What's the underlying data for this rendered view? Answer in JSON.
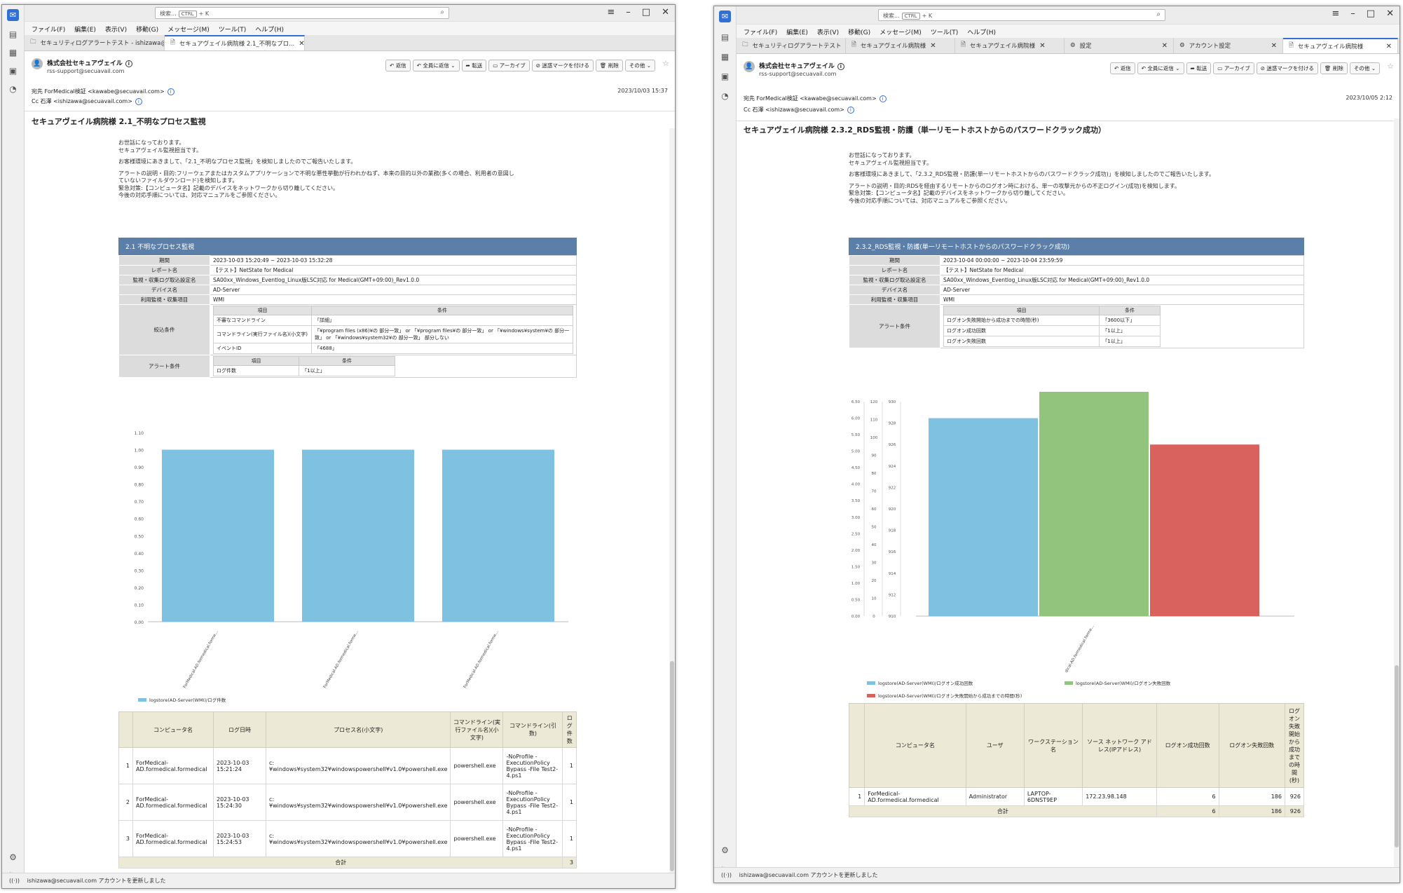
{
  "app": {
    "search_placeholder": "検索...",
    "search_key": "CTRL",
    "search_key2": "K",
    "menu": [
      "ファイル(F)",
      "編集(E)",
      "表示(V)",
      "移動(G)",
      "メッセージ(M)",
      "ツール(T)",
      "ヘルプ(H)"
    ],
    "status_text": "ishizawa@secuavail.com アカウントを更新しました",
    "sender_name": "株式会社セキュアヴェイル",
    "sender_email": "rss-support@secuavail.com",
    "actions": [
      "返信",
      "全員に返信",
      "転送",
      "アーカイブ",
      "迷惑マークを付ける",
      "削除",
      "その他"
    ]
  },
  "window1": {
    "tabs": [
      {
        "label": "セキュリティログアラートテスト - ishizawa@...",
        "active": false
      },
      {
        "label": "セキュアヴェイル病院様 2.1_不明なプロ...",
        "active": true
      }
    ],
    "to": "宛先 ForMedical検証 <kawabe@secuavail.com>",
    "cc": "Cc 石澤 <ishizawa@secuavail.com>",
    "date": "2023/10/03 15:37",
    "subject": "セキュアヴェイル病院様 2.1_不明なプロセス監視",
    "body": [
      "お世話になっております。",
      "セキュアヴェイル監視担当です。",
      "",
      "お客様環境にあきまして、「2.1_不明なプロセス監視」を検知しましたのでご報告いたします。",
      "",
      "アラートの説明・目的:フリーウェアまたはカスタムアプリケーションで不明な悪性挙動が行われかねず、本来の目的以外の業務(多くの場合、利用者の意図し",
      "ていないファイルダウンロード)を検知します。",
      "緊急対策:【コンピュータ名】記載のデバイスをネットワークから切り離してください。",
      "今後の対応手順については、対応マニュアルをご参照ください。"
    ],
    "report": {
      "heading": "2.1 不明なプロセス監視",
      "rows": [
        {
          "k": "期間",
          "v": "2023-10-03 15:20:49 ~ 2023-10-03 15:32:28"
        },
        {
          "k": "レポート名",
          "v": "【テスト】NetState for Medical"
        },
        {
          "k": "監視・収集ログ取込設定名",
          "v": "SA00xx_Windows_Eventlog_Linux版LSC対応 for Medical(GMT+09:00)_Rev1.0.0"
        },
        {
          "k": "デバイス名",
          "v": "AD-Server"
        },
        {
          "k": "利用監視・収集項目",
          "v": "WMI"
        }
      ],
      "filter_label": "絞込条件",
      "filter_head": [
        "項目",
        "条件"
      ],
      "filters": [
        [
          "不審なコマンドライン",
          "「詳細」"
        ],
        [
          "コマンドライン(実行ファイル名)(小文字)",
          "「¥program files (x86)¥の 部分一致」 or 「¥program files¥の 部分一致」 or 「¥windows¥system¥の 部分一致」 or 「¥windows¥system32¥の 部分一致」 部分しない"
        ],
        [
          "イベントID",
          "「4688」"
        ]
      ],
      "alert_label": "アラート条件",
      "alert_head": [
        "項目",
        "条件"
      ],
      "alerts": [
        [
          "ログ件数",
          "「1以上」"
        ]
      ]
    },
    "table": {
      "headers": [
        "",
        "コンピュータ名",
        "ログ日時",
        "プロセス名(小文字)",
        "コマンドライン(実行ファイル名)(小文字)",
        "コマンドライン(引数)",
        "ログ件数"
      ],
      "rows": [
        [
          "1",
          "ForMedical-AD.formedical.formedical",
          "2023-10-03 15:21:24",
          "c:¥windows¥system32¥windowspowershell¥v1.0¥powershell.exe",
          "powershell.exe",
          "-NoProfile -ExecutionPolicy Bypass -File Test2-4.ps1",
          "1"
        ],
        [
          "2",
          "ForMedical-AD.formedical.formedical",
          "2023-10-03 15:24:30",
          "c:¥windows¥system32¥windowspowershell¥v1.0¥powershell.exe",
          "powershell.exe",
          "-NoProfile -ExecutionPolicy Bypass -File Test2-4.ps1",
          "1"
        ],
        [
          "3",
          "ForMedical-AD.formedical.formedical",
          "2023-10-03 15:24:53",
          "c:¥windows¥system32¥windowspowershell¥v1.0¥powershell.exe",
          "powershell.exe",
          "-NoProfile -ExecutionPolicy Bypass -File Test2-4.ps1",
          "1"
        ]
      ],
      "total_label": "合計",
      "total_value": "3"
    }
  },
  "window2": {
    "tabs": [
      {
        "label": "セキュリティログアラートテスト",
        "active": false
      },
      {
        "label": "セキュアヴェイル病院様",
        "active": false
      },
      {
        "label": "セキュアヴェイル病院様",
        "active": false
      },
      {
        "label": "設定",
        "active": false
      },
      {
        "label": "アカウント設定",
        "active": false
      },
      {
        "label": "セキュアヴェイル病院様",
        "active": true
      }
    ],
    "to": "宛先 ForMedical検証 <kawabe@secuavail.com>",
    "cc": "Cc 石澤 <ishizawa@secuavail.com>",
    "date": "2023/10/05 2:12",
    "subject": "セキュアヴェイル病院様 2.3.2_RDS監視・防護（単一リモートホストからのパスワードクラック成功）",
    "body": [
      "お世話になっております。",
      "セキュアヴェイル監視担当です。",
      "",
      "お客様環境にあきまして、「2.3.2_RDS監視・防護(単一リモートホストからのパスワードクラック成功)」を検知しましたのでご報告いたします。",
      "",
      "アラートの説明・目的:RDSを経由するリモートからのログオン時における、単一の攻撃元からの不正ログイン(成功)を検知します。",
      "緊急対策:【コンピュータ名】記載のデバイスをネットワークから切り離してください。",
      "今後の対応手順については、対応マニュアルをご参照ください。"
    ],
    "report": {
      "heading": "2.3.2_RDS監視・防護(単一リモートホストからのパスワードクラック成功)",
      "rows": [
        {
          "k": "期間",
          "v": "2023-10-04 00:00:00 ~ 2023-10-04 23:59:59"
        },
        {
          "k": "レポート名",
          "v": "【テスト】NetState for Medical"
        },
        {
          "k": "監視・収集ログ取込設定名",
          "v": "SA00xx_Windows_Eventlog_Linux版LSC対応 for Medical(GMT+09:00)_Rev1.0.0"
        },
        {
          "k": "デバイス名",
          "v": "AD-Server"
        },
        {
          "k": "利用監視・収集項目",
          "v": "WMI"
        }
      ],
      "alert_label": "アラート条件",
      "alert_head": [
        "項目",
        "条件"
      ],
      "alerts": [
        [
          "ログオン失敗開始から成功までの時間(秒)",
          "「3600以下」"
        ],
        [
          "ログオン成功回数",
          "「1以上」"
        ],
        [
          "ログオン失敗回数",
          "「1以上」"
        ]
      ]
    },
    "table": {
      "headers": [
        "",
        "コンピュータ名",
        "ユーザ",
        "ワークステーション名",
        "ソース ネットワーク アドレス(IPアドレス)",
        "ログオン成功回数",
        "ログオン失敗回数",
        "ログオン失敗開始から成功までの時間(秒)"
      ],
      "rows": [
        [
          "1",
          "ForMedical-AD.formedical.formedical",
          "Administrator",
          "LAPTOP-6DNST9EP",
          "172.23.98.148",
          "6",
          "186",
          "926"
        ]
      ],
      "total_label": "合計",
      "total_values": [
        "6",
        "186",
        "926"
      ]
    }
  },
  "chart_data": [
    {
      "type": "bar",
      "title": "",
      "categories": [
        "ForMedical-AD.formedical.forme...",
        "ForMedical-AD.formedical.forme...",
        "ForMedical-AD.formedical.forme..."
      ],
      "series": [
        {
          "name": "logstore(AD-Server(WMI)/ログ件数",
          "values": [
            1,
            1,
            1
          ],
          "color": "#7fc1e0"
        }
      ],
      "ylim": [
        0,
        1.1
      ],
      "yticks": [
        "0.00",
        "0.10",
        "0.20",
        "0.30",
        "0.40",
        "0.50",
        "0.60",
        "0.70",
        "0.80",
        "0.90",
        "1.00",
        "1.10"
      ],
      "grid": false,
      "legend": "bottom-left"
    },
    {
      "type": "bar",
      "title": "",
      "categories": [
        "ForMedical-AD.formedical.forme..."
      ],
      "series": [
        {
          "name": "logstore(AD-Server(WMI)/ログオン成功回数",
          "values": [
            6
          ],
          "color": "#7fc1e0",
          "axis_ticks": [
            "0.00",
            "0.50",
            "1.00",
            "1.50",
            "2.00",
            "2.50",
            "3.00",
            "3.50",
            "4.00",
            "4.50",
            "5.00",
            "5.50",
            "6.00",
            "6.50"
          ]
        },
        {
          "name": "logstore(AD-Server(WMI)/ログオン失敗回数",
          "values": [
            186
          ],
          "color": "#93c47d",
          "axis_ticks": [
            "0",
            "10",
            "20",
            "30",
            "40",
            "50",
            "60",
            "70",
            "80",
            "90",
            "100",
            "110",
            "120"
          ]
        },
        {
          "name": "logstore(AD-Server(WMI)/ログオン失敗開始から成功までの時間(秒)",
          "values": [
            926
          ],
          "color": "#d9625f",
          "axis_ticks": [
            "910",
            "912",
            "914",
            "916",
            "918",
            "920",
            "922",
            "924",
            "926",
            "928",
            "930"
          ]
        }
      ],
      "grid": false,
      "legend": "bottom"
    }
  ]
}
